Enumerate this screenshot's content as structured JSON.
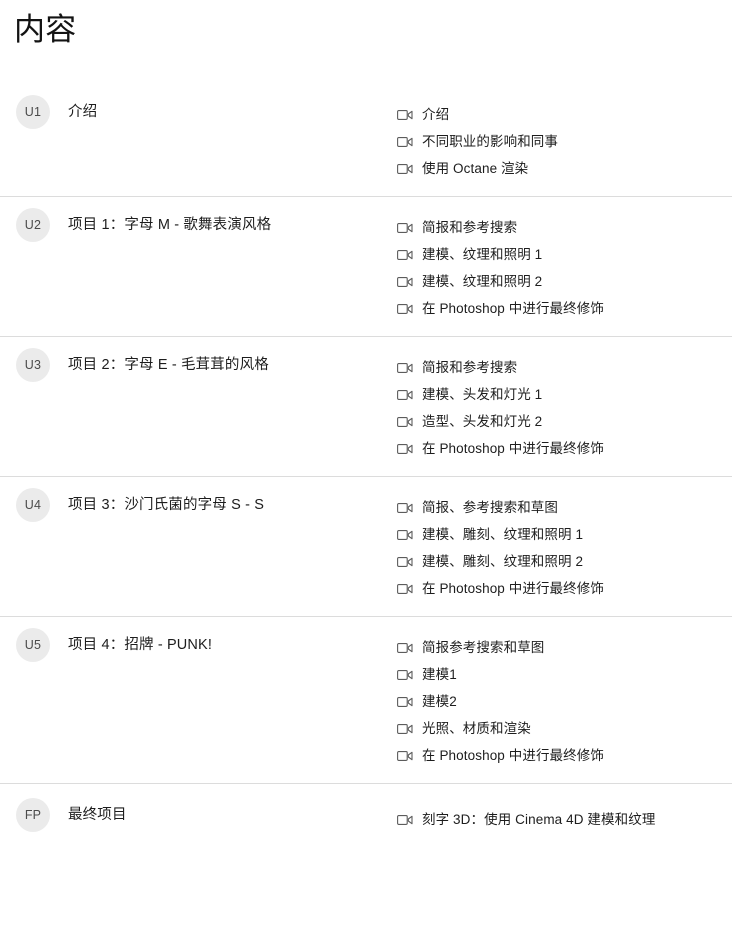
{
  "page": {
    "title": "内容"
  },
  "icons": {
    "lesson": "video-camera-icon"
  },
  "sections": [
    {
      "badge": "U1",
      "title": "介绍",
      "lessons": [
        "介绍",
        "不同职业的影响和同事",
        "使用 Octane 渲染"
      ]
    },
    {
      "badge": "U2",
      "title": "项目 1：字母 M - 歌舞表演风格",
      "lessons": [
        "简报和参考搜索",
        "建模、纹理和照明 1",
        "建模、纹理和照明 2",
        "在 Photoshop 中进行最终修饰"
      ]
    },
    {
      "badge": "U3",
      "title": "项目 2：字母 E - 毛茸茸的风格",
      "lessons": [
        "简报和参考搜索",
        "建模、头发和灯光 1",
        "造型、头发和灯光 2",
        "在 Photoshop 中进行最终修饰"
      ]
    },
    {
      "badge": "U4",
      "title": "项目 3：沙门氏菌的字母 S - S",
      "lessons": [
        "简报、参考搜索和草图",
        "建模、雕刻、纹理和照明 1",
        "建模、雕刻、纹理和照明 2",
        "在 Photoshop 中进行最终修饰"
      ]
    },
    {
      "badge": "U5",
      "title": "项目 4：招牌 - PUNK!",
      "lessons": [
        "简报参考搜索和草图",
        "建模1",
        "建模2",
        "光照、材质和渲染",
        "在 Photoshop 中进行最终修饰"
      ]
    },
    {
      "badge": "FP",
      "title": "最终项目",
      "lessons": [
        "刻字 3D：使用 Cinema 4D 建模和纹理"
      ]
    }
  ],
  "colors": {
    "badge_background": "#ebebeb",
    "badge_text": "#4b4b4b",
    "divider": "#dcdcdc",
    "text": "#1d1d1d",
    "background": "#ffffff"
  }
}
